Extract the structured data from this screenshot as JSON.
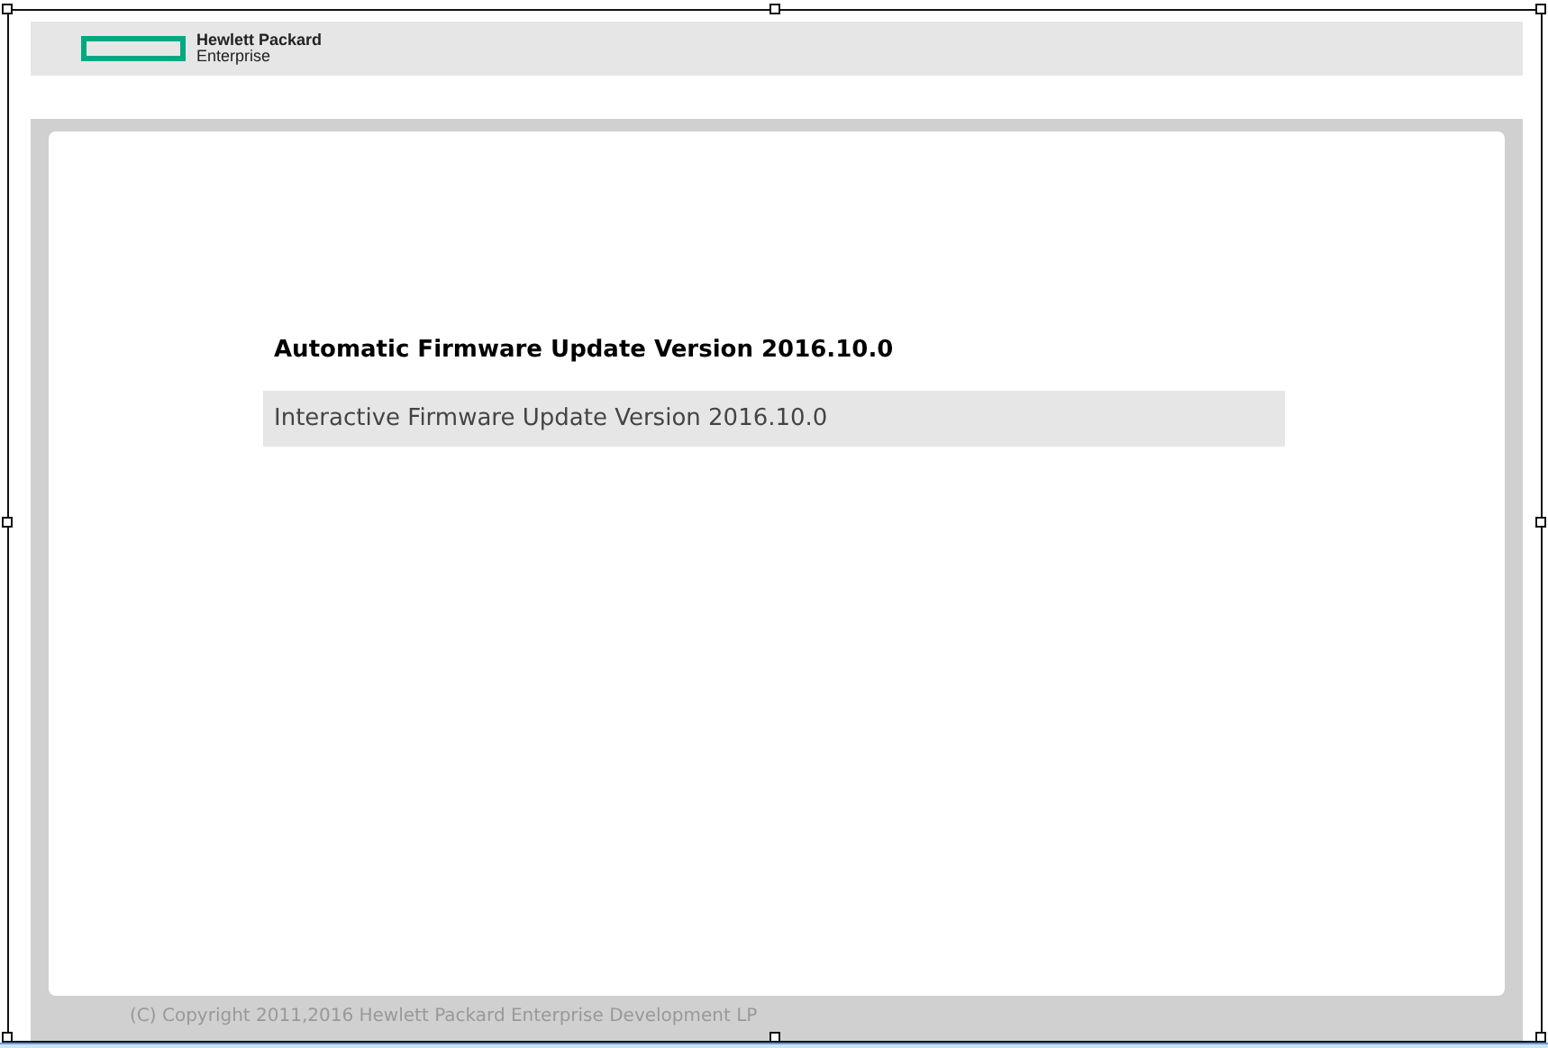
{
  "header": {
    "logo_line_1": "Hewlett Packard",
    "logo_line_2": "Enterprise"
  },
  "menu": {
    "items": [
      {
        "label": "Automatic Firmware Update Version 2016.10.0",
        "selected": true,
        "highlighted": false
      },
      {
        "label": "Interactive Firmware Update Version 2016.10.0",
        "selected": false,
        "highlighted": true
      }
    ]
  },
  "footer": {
    "copyright": "(C) Copyright 2011,2016 Hewlett Packard Enterprise Development LP"
  }
}
